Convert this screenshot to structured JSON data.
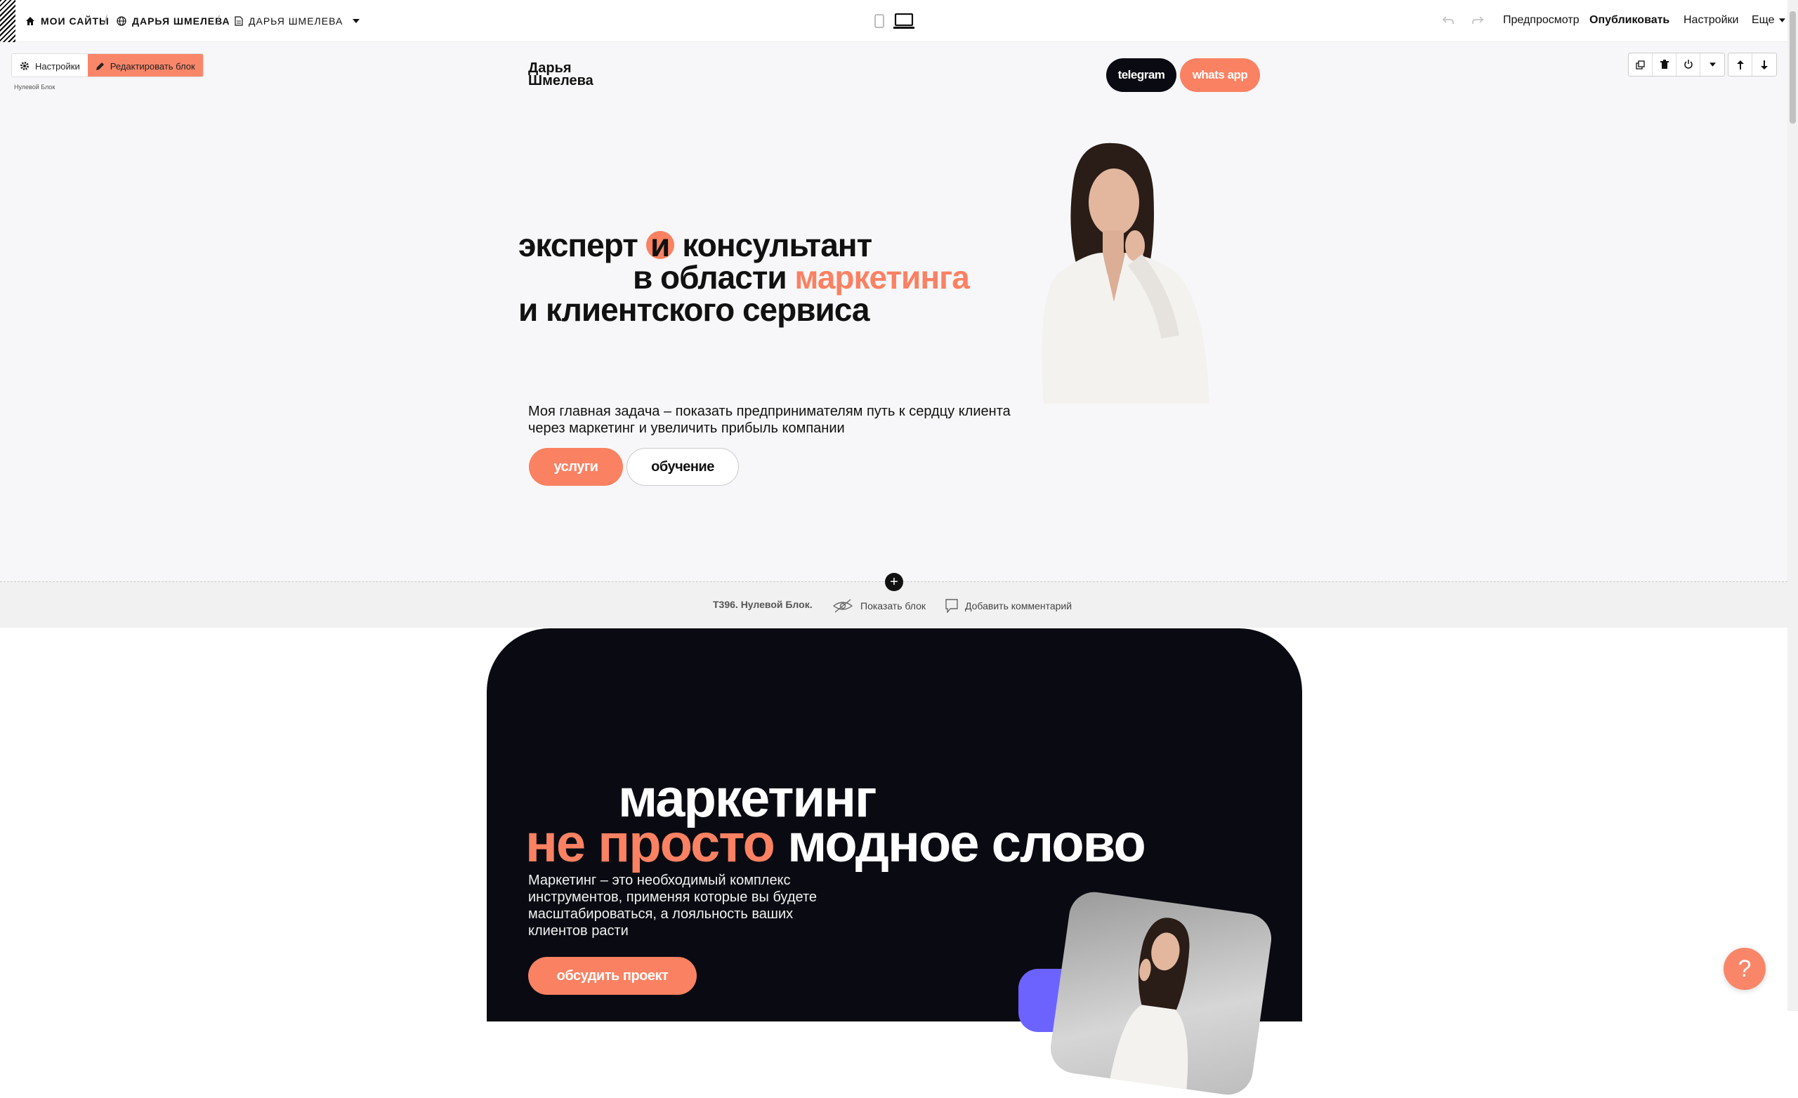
{
  "topbar": {
    "breadcrumbs": [
      {
        "label": "Мои сайты",
        "icon": "home-icon"
      },
      {
        "label": "Дарья Шмелева",
        "icon": "globe-icon"
      },
      {
        "label": "Дарья Шмелева",
        "icon": "page-icon"
      }
    ],
    "actions": {
      "preview": "Предпросмотр",
      "publish": "Опубликовать",
      "settings": "Настройки",
      "more": "Еще"
    }
  },
  "block_controls": {
    "settings": "Настройки",
    "edit": "Редактировать блок",
    "label": "Нулевой Блок"
  },
  "hero": {
    "brand_line1": "Дарья",
    "brand_line2": "Шмелева",
    "telegram": "telegram",
    "whatsapp": "whats app",
    "headline": {
      "w1": "эксперт",
      "and": "и",
      "w2": "консультант",
      "w3": "в области",
      "w4": "маркетинга",
      "w5": "и клиентского сервиса"
    },
    "subtext": "Моя главная задача – показать предпринимателям путь к сердцу клиента через маркетинг и увеличить прибыль компании",
    "btn_services": "услуги",
    "btn_training": "обучение"
  },
  "divider": {
    "block_id": "T396. Нулевой Блок.",
    "show_block": "Показать блок",
    "add_comment": "Добавить комментарий"
  },
  "marketing": {
    "line1": "маркетинг",
    "line2_orange": "не просто",
    "line2_white": "модное слово",
    "text": "Маркетинг – это необходимый  комплекс инструментов, применяя  которые вы будете масштабироваться,  а лояльность ваших клиентов расти",
    "cta": "обсудить проект"
  },
  "help": "?",
  "colors": {
    "accent": "#fa8162",
    "dark": "#0a0b12",
    "bg": "#f7f7f9"
  }
}
